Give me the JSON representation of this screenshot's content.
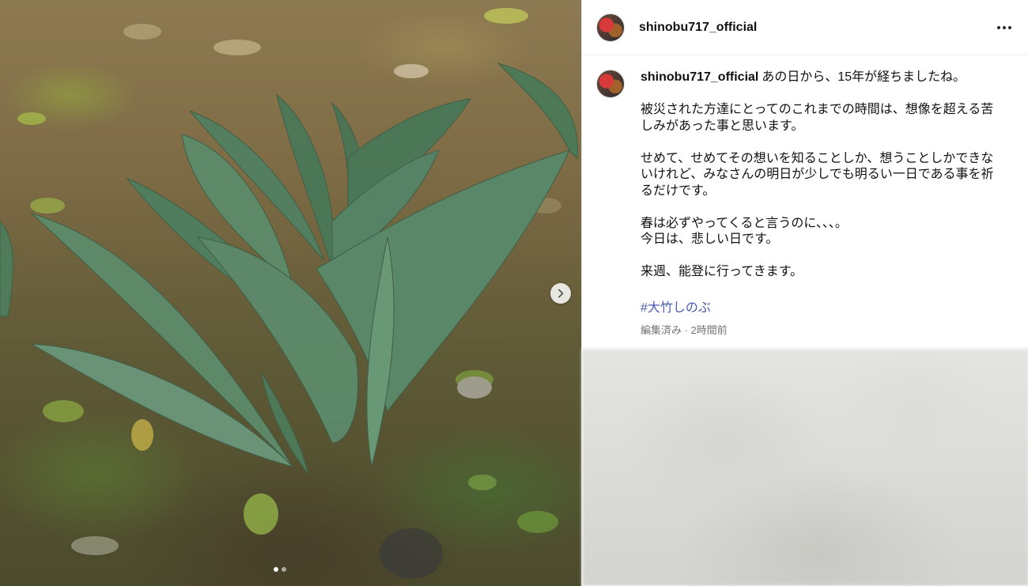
{
  "post": {
    "username": "shinobu717_official",
    "more_icon": "more-horizontal-icon",
    "carousel": {
      "next_icon": "chevron-right-icon",
      "dot_count": 2,
      "active_index": 0
    }
  },
  "caption": {
    "username": "shinobu717_official",
    "first_line": "あの日から、15年が経ちましたね。",
    "paragraphs": [
      "被災された方達にとってのこれまでの時間は、想像を超える苦しみがあった事と思います。",
      "せめて、せめてその想いを知ることしか、想うことしかできないけれど、みなさんの明日が少しでも明るい一日である事を祈るだけです。",
      "春は必ずやってくると言うのに、、、。\n今日は、悲しい日です。",
      "来週、能登に行ってきます。"
    ],
    "hashtag": "#大竹しのぶ",
    "meta": "編集済み · 2時間前"
  },
  "colors": {
    "hashtag": "#4a5bb0",
    "meta_text": "#737373",
    "border": "#dbdbdb"
  }
}
